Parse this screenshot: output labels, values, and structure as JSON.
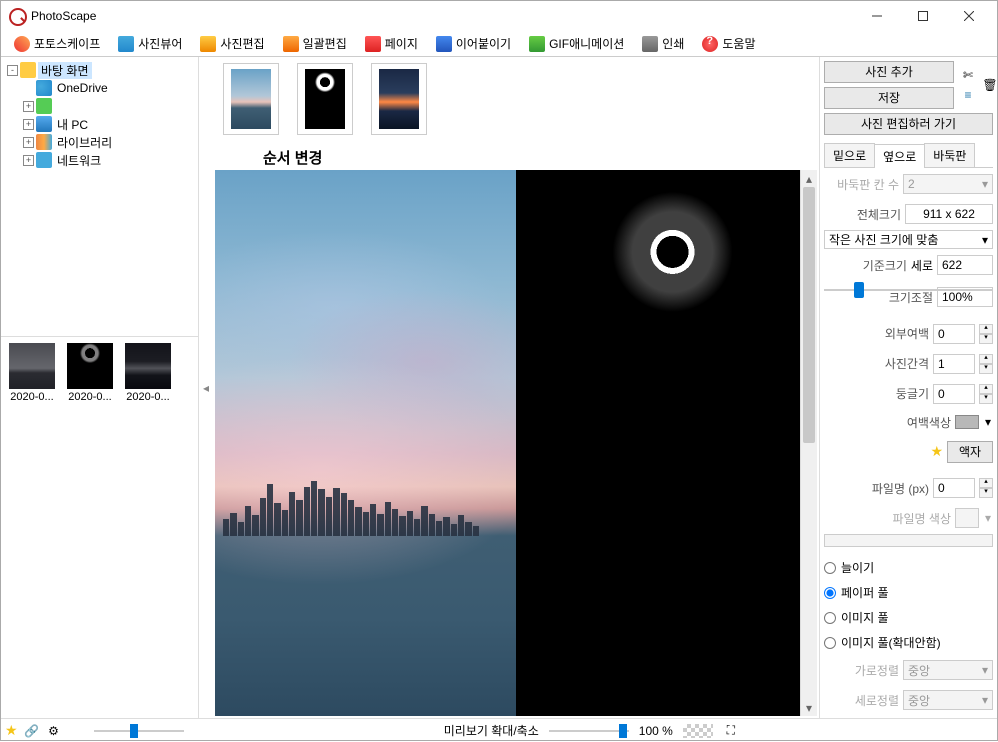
{
  "window": {
    "title": "PhotoScape"
  },
  "toolbar": [
    {
      "icon": "ic-app",
      "label": "포토스케이프"
    },
    {
      "icon": "ic-viewer",
      "label": "사진뷰어"
    },
    {
      "icon": "ic-edit",
      "label": "사진편집"
    },
    {
      "icon": "ic-batch",
      "label": "일괄편집"
    },
    {
      "icon": "ic-page",
      "label": "페이지"
    },
    {
      "icon": "ic-combine",
      "label": "이어붙이기"
    },
    {
      "icon": "ic-gif",
      "label": "GIF애니메이션"
    },
    {
      "icon": "ic-print",
      "label": "인쇄"
    },
    {
      "icon": "ic-help",
      "label": "도움말"
    }
  ],
  "tree": [
    {
      "depth": 0,
      "exp": "-",
      "icon": "t-desktop",
      "label": "바탕 화면",
      "sel": true
    },
    {
      "depth": 1,
      "exp": "",
      "icon": "t-onedrive",
      "label": "OneDrive"
    },
    {
      "depth": 1,
      "exp": "+",
      "icon": "t-user",
      "label": ""
    },
    {
      "depth": 1,
      "exp": "+",
      "icon": "t-pc",
      "label": "내 PC"
    },
    {
      "depth": 1,
      "exp": "+",
      "icon": "t-lib",
      "label": "라이브러리"
    },
    {
      "depth": 1,
      "exp": "+",
      "icon": "t-net",
      "label": "네트워크"
    }
  ],
  "thumbs": [
    {
      "art": "t-city",
      "label": "2020-0..."
    },
    {
      "art": "t-eclipse",
      "label": "2020-0..."
    },
    {
      "art": "t-sunset",
      "label": "2020-0..."
    }
  ],
  "strip_caption": "순서 변경",
  "strip_thumbs": [
    {
      "art": "t-city"
    },
    {
      "art": "t-eclipse"
    },
    {
      "art": "t-sunset"
    }
  ],
  "right": {
    "add_photo": "사진 추가",
    "save": "저장",
    "goto_edit": "사진 편집하러 가기",
    "tabs": [
      "밑으로",
      "옆으로",
      "바둑판"
    ],
    "active_tab": 1,
    "grid_cols_label": "바둑판 칸 수",
    "grid_cols_value": "2",
    "total_size_label": "전체크기",
    "total_size_value": "911 x 622",
    "fit_select": "작은 사진 크기에 맞춤",
    "base_size_label": "기준크기",
    "base_axis": "세로",
    "base_value": "622",
    "resize_label": "크기조절",
    "resize_value": "100%",
    "outer_margin_label": "외부여백",
    "outer_margin_value": "0",
    "gap_label": "사진간격",
    "gap_value": "1",
    "round_label": "둥글기",
    "round_value": "0",
    "margin_color_label": "여백색상",
    "frame_btn": "액자",
    "filename_label": "파일명 (px)",
    "filename_value": "0",
    "filename_color_label": "파일명 색상",
    "radio_stretch": "늘이기",
    "radio_paper": "페이퍼 풀",
    "radio_image": "이미지 풀",
    "radio_image_noenlarge": "이미지 풀(확대안함)",
    "halign_label": "가로정렬",
    "halign_value": "중앙",
    "valign_label": "세로정렬",
    "valign_value": "중앙"
  },
  "footer": {
    "preview_label": "미리보기 확대/축소",
    "zoom_value": "100 %"
  }
}
